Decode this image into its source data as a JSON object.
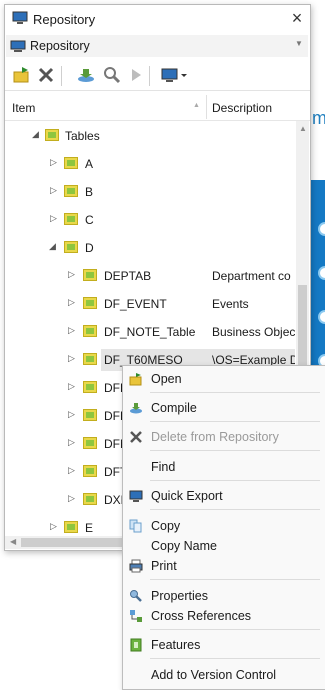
{
  "window": {
    "title": "Repository",
    "selector_label": "Repository",
    "close_glyph": "×"
  },
  "toolbar": {
    "icons": [
      "folder-open-icon",
      "delete-icon",
      "compile-icon",
      "search-icon",
      "run-icon",
      "monitor-dropdown-icon"
    ]
  },
  "columns": {
    "item": "Item",
    "description": "Description"
  },
  "tree": [
    {
      "name": "Tables",
      "desc": "",
      "expanded": true
    },
    {
      "name": "A",
      "desc": ""
    },
    {
      "name": "B",
      "desc": ""
    },
    {
      "name": "C",
      "desc": ""
    },
    {
      "name": "D",
      "desc": "",
      "expanded": true
    },
    {
      "name": "DEPTAB",
      "desc": "Department co"
    },
    {
      "name": "DF_EVENT",
      "desc": "Events"
    },
    {
      "name": "DF_NOTE_Table",
      "desc": "Business Object"
    },
    {
      "name": "DF_T60MESO",
      "desc": "\\OS=Example D",
      "selected": true
    },
    {
      "name": "DFD",
      "desc": ""
    },
    {
      "name": "DFD",
      "desc": ""
    },
    {
      "name": "DFN",
      "desc": ""
    },
    {
      "name": "DFT",
      "desc": ""
    },
    {
      "name": "DXD",
      "desc": ""
    },
    {
      "name": "E",
      "desc": ""
    }
  ],
  "context_menu": {
    "open": "Open",
    "compile": "Compile",
    "delete": "Delete from Repository",
    "find": "Find",
    "quick_export": "Quick Export",
    "copy": "Copy",
    "copy_name": "Copy Name",
    "print": "Print",
    "properties": "Properties",
    "cross_references": "Cross References",
    "features": "Features",
    "add_vc": "Add to Version Control"
  },
  "colors": {
    "folder": "#e9d84a",
    "folder_inner": "#8ec63f",
    "accent_blue": "#1479c4"
  }
}
